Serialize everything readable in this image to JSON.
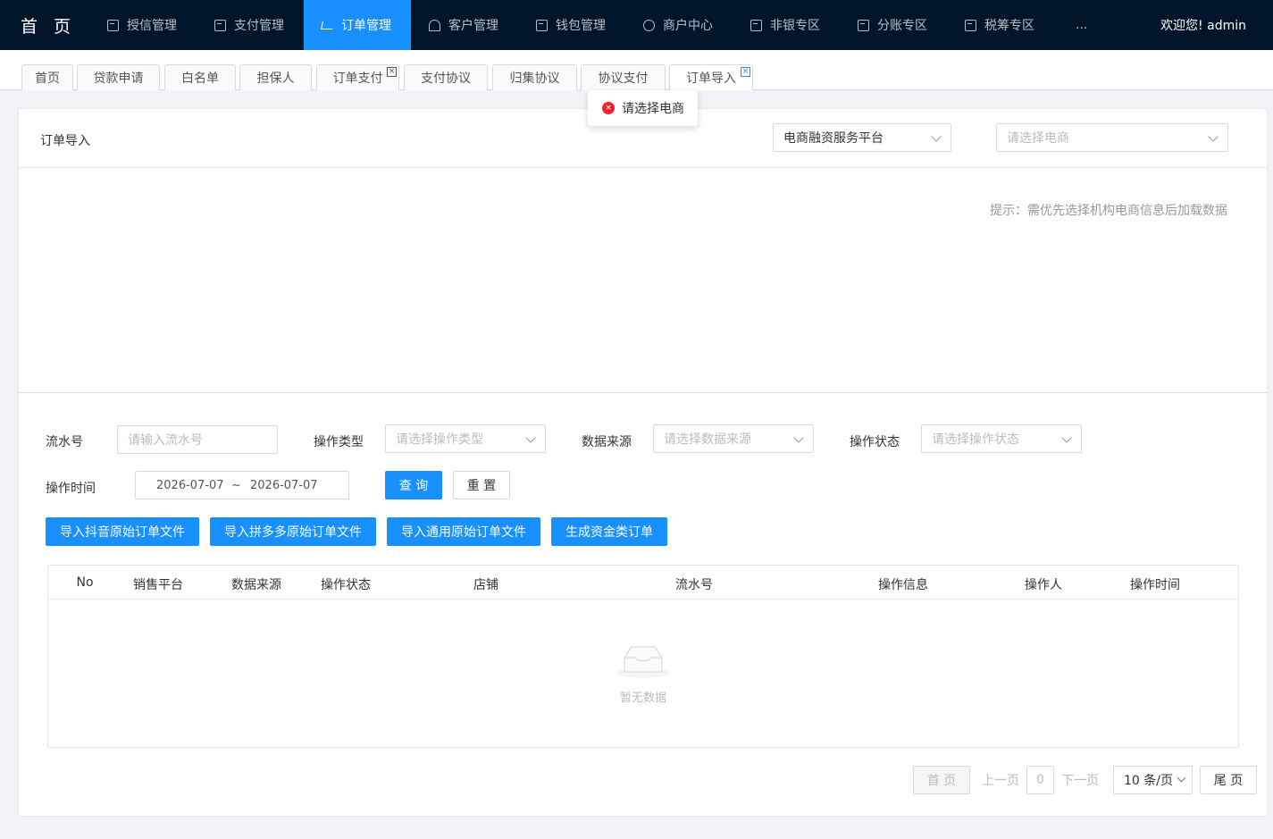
{
  "nav": {
    "brand": "首 页",
    "items": [
      {
        "label": "授信管理",
        "icon": "form-icon"
      },
      {
        "label": "支付管理",
        "icon": "doc-icon"
      },
      {
        "label": "订单管理",
        "icon": "cart-icon"
      },
      {
        "label": "客户管理",
        "icon": "user-icon"
      },
      {
        "label": "钱包管理",
        "icon": "form-icon"
      },
      {
        "label": "商户中心",
        "icon": "clock-icon"
      },
      {
        "label": "非银专区",
        "icon": "doc-icon"
      },
      {
        "label": "分账专区",
        "icon": "doc-icon"
      },
      {
        "label": "税筹专区",
        "icon": "doc-icon"
      }
    ],
    "more": "...",
    "welcome": "欢迎您! admin",
    "active_color": "#1890ff"
  },
  "tabs": [
    "首页",
    "贷款申请",
    "白名单",
    "担保人",
    "订单支付",
    "支付协议",
    "归集协议",
    "协议支付",
    "订单导入"
  ],
  "tab_close": "×",
  "toast": {
    "message": "请选择电商",
    "icon": "×"
  },
  "header": {
    "title": "订单导入",
    "platform_select": "电商融资服务平台",
    "merchant_placeholder": "请选择电商",
    "hint": "提示：需优先选择机构电商信息后加载数据"
  },
  "filters": {
    "serial_label": "流水号",
    "serial_placeholder": "请输入流水号",
    "op_type_label": "操作类型",
    "op_type_placeholder": "请选择操作类型",
    "source_label": "数据来源",
    "source_placeholder": "请选择数据来源",
    "status_label": "操作状态",
    "status_placeholder": "请选择操作状态",
    "time_label": "操作时间",
    "date_start": "2026-07-07",
    "date_sep": "~",
    "date_end": "2026-07-07",
    "query": "查 询",
    "reset": "重 置"
  },
  "actions": [
    "导入抖音原始订单文件",
    "导入拼多多原始订单文件",
    "导入通用原始订单文件",
    "生成资金类订单"
  ],
  "table": {
    "columns": [
      "No",
      "销售平台",
      "数据来源",
      "操作状态",
      "店铺",
      "流水号",
      "操作信息",
      "操作人",
      "操作时间"
    ],
    "empty": "暂无数据"
  },
  "pagination": {
    "first": "首 页",
    "prev": "上一页",
    "page": "0",
    "next": "下一页",
    "size": "10 条/页",
    "last": "尾 页"
  }
}
